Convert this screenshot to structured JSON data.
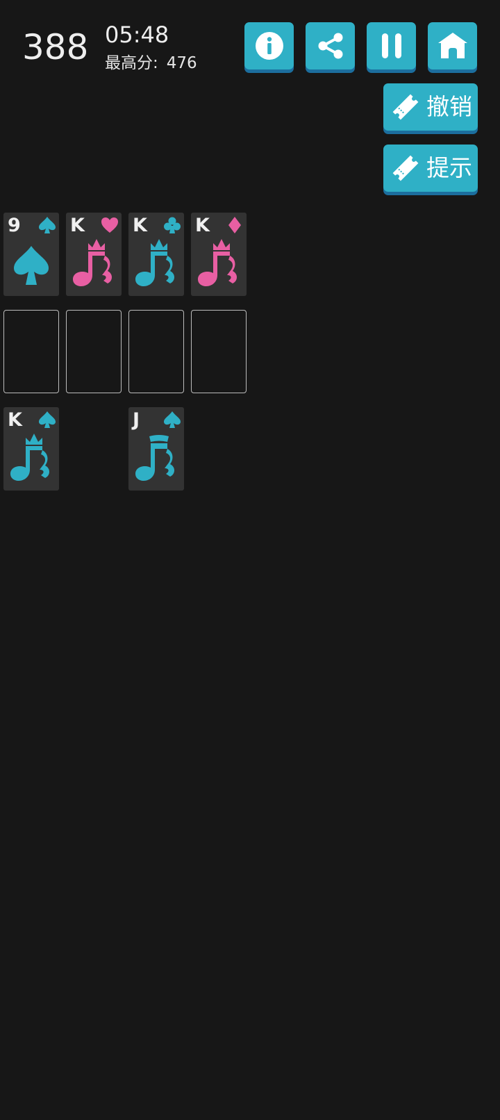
{
  "header": {
    "score": "388",
    "timer": "05:48",
    "best_label": "最高分:",
    "best_value": "476"
  },
  "buttons": {
    "info": {
      "icon": "info-icon"
    },
    "share": {
      "icon": "share-icon"
    },
    "pause": {
      "icon": "pause-icon"
    },
    "home": {
      "icon": "home-icon"
    },
    "undo": {
      "label": "撤销",
      "icon": "ticket-icon"
    },
    "hint": {
      "label": "提示",
      "icon": "ticket-icon"
    }
  },
  "colors": {
    "background": "#171717",
    "accent": "#2fb0c6",
    "accent_shadow": "#1c6e9e",
    "card": "#333333",
    "black_suit": "#2fb0c6",
    "red_suit": "#e85fa3"
  },
  "foundation": [
    {
      "rank": "9",
      "suit": "spade",
      "color": "black"
    },
    {
      "rank": "K",
      "suit": "heart",
      "color": "red"
    },
    {
      "rank": "K",
      "suit": "club",
      "color": "black"
    },
    {
      "rank": "K",
      "suit": "diamond",
      "color": "red"
    }
  ],
  "empty_slots": 4,
  "tableau": [
    {
      "column": 1,
      "rank": "K",
      "suit": "spade",
      "color": "black"
    },
    {
      "column": 2,
      "rank": "",
      "suit": "",
      "color": ""
    },
    {
      "column": 3,
      "rank": "J",
      "suit": "spade",
      "color": "black"
    },
    {
      "column": 4,
      "rank": "",
      "suit": "",
      "color": ""
    }
  ]
}
